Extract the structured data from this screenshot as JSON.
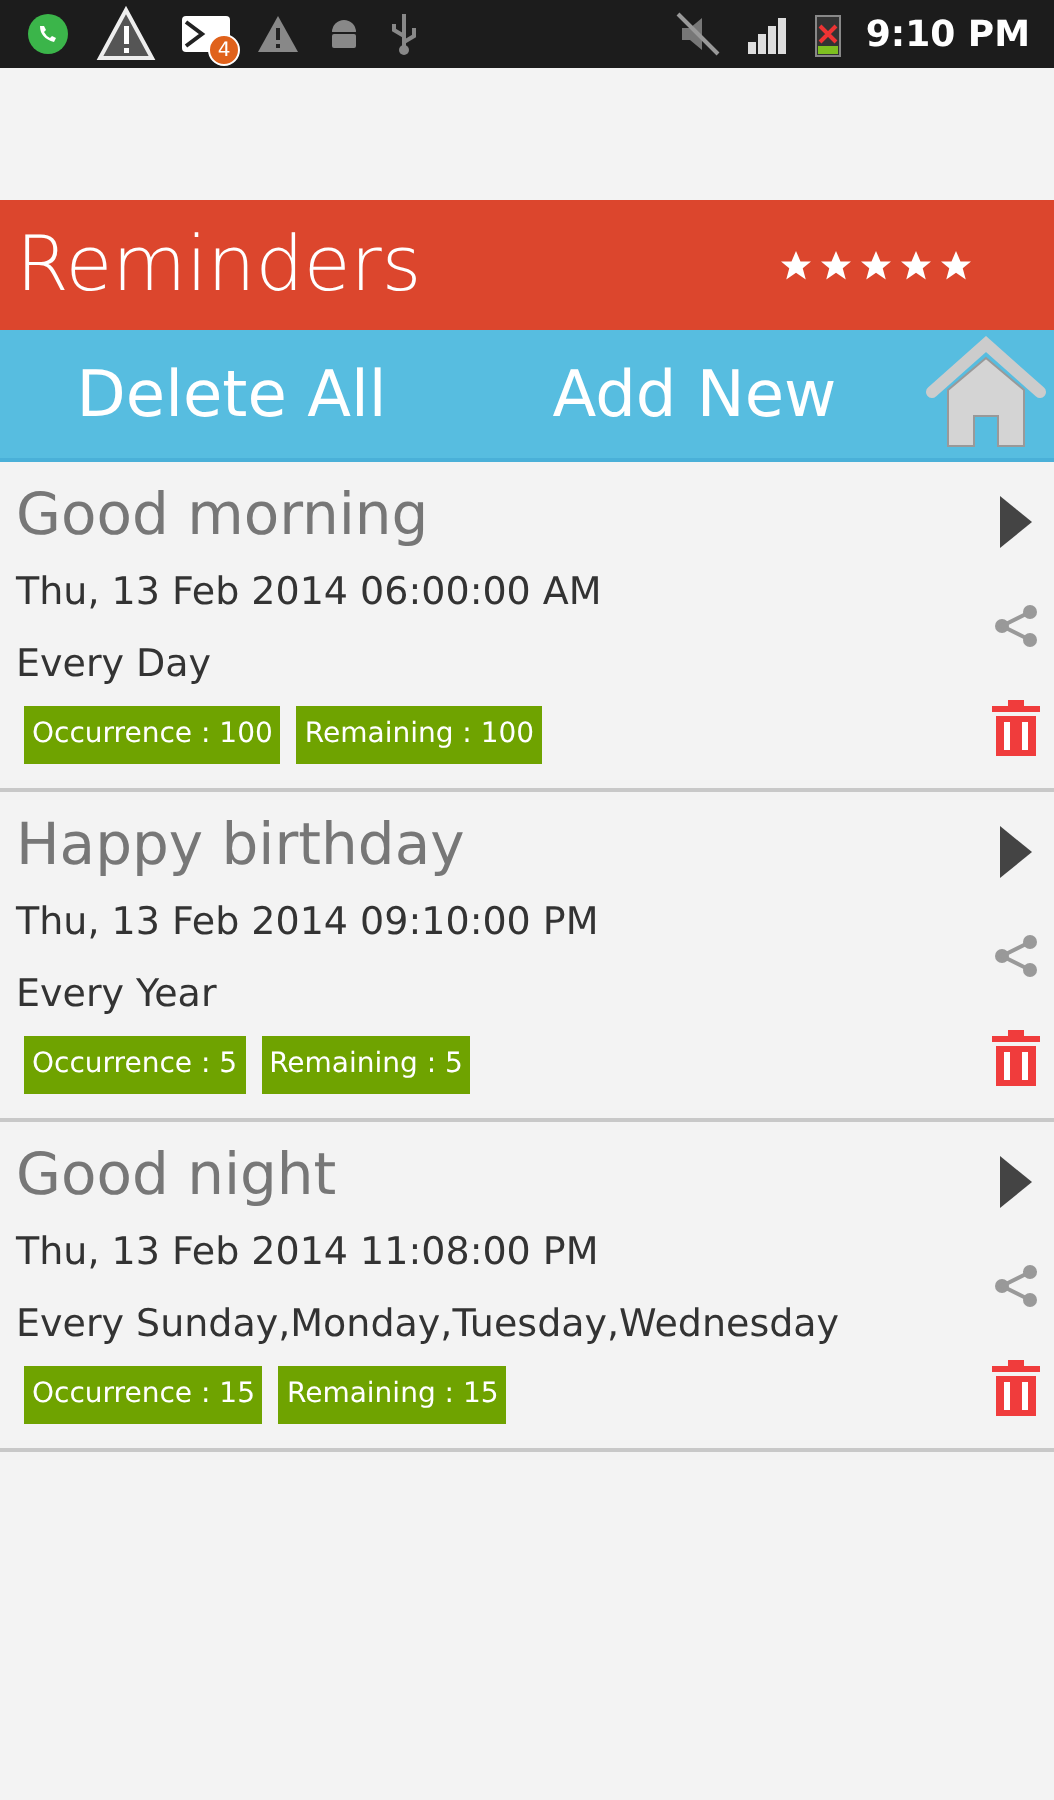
{
  "status_bar": {
    "notification_count": "4",
    "time": "9:10 PM"
  },
  "header": {
    "title": "Reminders",
    "stars": 5
  },
  "toolbar": {
    "buttons": [
      "Delete All",
      "Add New"
    ]
  },
  "reminders": [
    {
      "title": "Good morning",
      "datetime": "Thu, 13 Feb 2014 06:00:00 AM",
      "repeat": "Every Day",
      "occurrence": "Occurrence : 100",
      "remaining": "Remaining : 100"
    },
    {
      "title": "Happy birthday",
      "datetime": "Thu, 13 Feb 2014 09:10:00 PM",
      "repeat": "Every Year",
      "occurrence": "Occurrence : 5",
      "remaining": "Remaining : 5"
    },
    {
      "title": "Good night",
      "datetime": "Thu, 13 Feb 2014 11:08:00 PM",
      "repeat": "Every Sunday,Monday,Tuesday,Wednesday",
      "occurrence": "Occurrence : 15",
      "remaining": "Remaining : 15"
    }
  ]
}
